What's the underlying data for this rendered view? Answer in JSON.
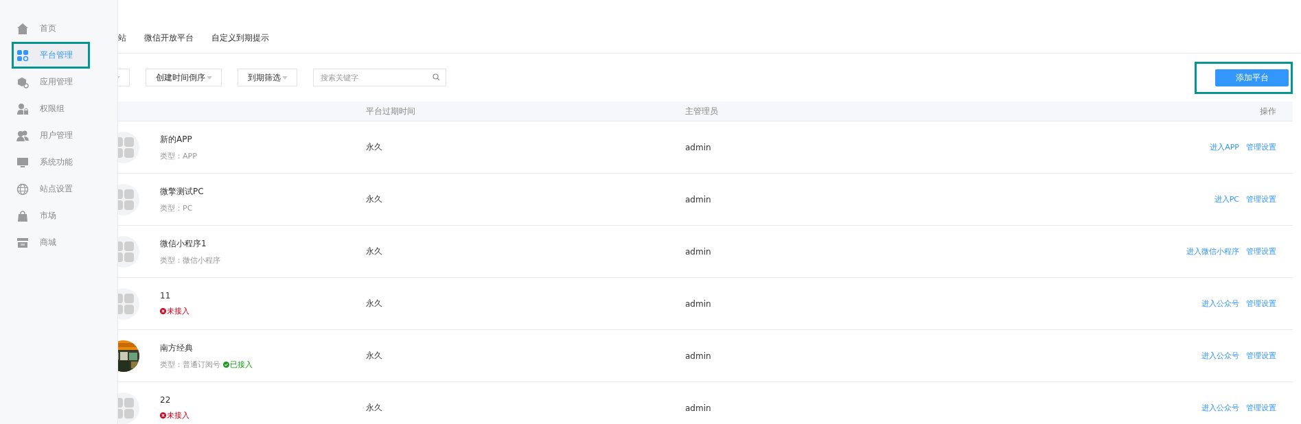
{
  "sidebar": {
    "items": [
      {
        "label": "首页",
        "selected": false,
        "highlighted": false
      },
      {
        "label": "平台管理",
        "selected": true,
        "highlighted": true
      },
      {
        "label": "应用管理",
        "selected": false,
        "highlighted": false
      },
      {
        "label": "权限组",
        "selected": false,
        "highlighted": false
      },
      {
        "label": "用户管理",
        "selected": false,
        "highlighted": false
      },
      {
        "label": "系统功能",
        "selected": false,
        "highlighted": false
      },
      {
        "label": "站点设置",
        "selected": false,
        "highlighted": false
      },
      {
        "label": "市场",
        "selected": false,
        "highlighted": false
      },
      {
        "label": "商城",
        "selected": false,
        "highlighted": false
      }
    ]
  },
  "tabs": [
    {
      "label": "站",
      "selected": false
    },
    {
      "label": "微信开放平台",
      "selected": false
    },
    {
      "label": "自定义到期提示",
      "selected": false
    }
  ],
  "filters": {
    "dropdowns": [
      {
        "kind": "cut_off"
      },
      {
        "kind": "select",
        "label": "创建时间倒序"
      },
      {
        "kind": "select",
        "label": "到期筛选"
      }
    ],
    "search": {
      "placeholder": "搜索关键字"
    },
    "add_button": {
      "label": "添加平台",
      "highlighted": true
    }
  },
  "table": {
    "columns": [
      "平台过期时间",
      "主管理员",
      "操作"
    ],
    "rows": [
      {
        "avatar": {
          "kind": "placeholder"
        },
        "name": "新的APP",
        "type": "类型：APP",
        "expires": "永久",
        "admin": "admin",
        "actions": [
          "进入APP",
          "管理设置"
        ]
      },
      {
        "avatar": {
          "kind": "placeholder"
        },
        "name": "微擎测试PC",
        "type": "类型：PC",
        "expires": "永久",
        "admin": "admin",
        "actions": [
          "进入PC",
          "管理设置"
        ]
      },
      {
        "avatar": {
          "kind": "placeholder"
        },
        "name": "微信小程序1",
        "type": "类型：微信小程序",
        "expires": "永久",
        "admin": "admin",
        "actions": [
          "进入微信小程序",
          "管理设置"
        ]
      },
      {
        "avatar": {
          "kind": "placeholder"
        },
        "name": "11",
        "status": {
          "connected": false,
          "text": "未接入"
        },
        "expires": "永久",
        "admin": "admin",
        "actions": [
          "进入公众号",
          "管理设置"
        ]
      },
      {
        "avatar": {
          "kind": "picture"
        },
        "name": "南方经典",
        "type": "类型：普通订阅号",
        "status": {
          "connected": true,
          "text": "已接入"
        },
        "expires": "永久",
        "admin": "admin",
        "actions": [
          "进入公众号",
          "管理设置"
        ]
      },
      {
        "avatar": {
          "kind": "placeholder"
        },
        "name": "22",
        "status": {
          "connected": false,
          "text": "未接入"
        },
        "expires": "永久",
        "admin": "admin",
        "actions": [
          "进入公众号",
          "管理设置"
        ]
      }
    ]
  }
}
